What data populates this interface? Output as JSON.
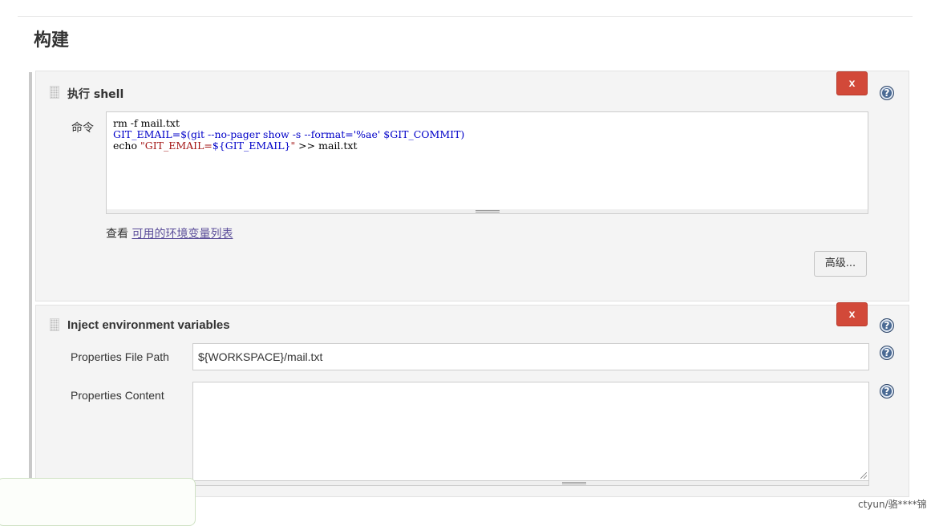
{
  "section": {
    "title": "构建"
  },
  "shell_step": {
    "title": "执行 shell",
    "delete_label": "x",
    "help_label": "?",
    "command_label": "命令",
    "command_lines": [
      {
        "parts": [
          {
            "t": "rm -f mail.txt",
            "c": "plain"
          }
        ]
      },
      {
        "parts": [
          {
            "t": "GIT_EMAIL=$(git --no-pager show -s --format='%ae' $GIT_COMMIT)",
            "c": "var"
          }
        ]
      },
      {
        "parts": [
          {
            "t": "echo ",
            "c": "plain"
          },
          {
            "t": "\"GIT_EMAIL=",
            "c": "str"
          },
          {
            "t": "${GIT_EMAIL}",
            "c": "var"
          },
          {
            "t": "\"",
            "c": "str"
          },
          {
            "t": " >> mail.txt",
            "c": "plain"
          }
        ]
      }
    ],
    "env_prefix": "查看 ",
    "env_link": "可用的环境变量列表",
    "advanced_label": "高级..."
  },
  "inject_step": {
    "title": "Inject environment variables",
    "delete_label": "x",
    "help_label": "?",
    "file_path_label": "Properties File Path",
    "file_path_value": "${WORKSPACE}/mail.txt",
    "file_path_help": "?",
    "content_label": "Properties Content",
    "content_value": "",
    "content_help": "?"
  },
  "watermark": "ctyun/骆****锦"
}
